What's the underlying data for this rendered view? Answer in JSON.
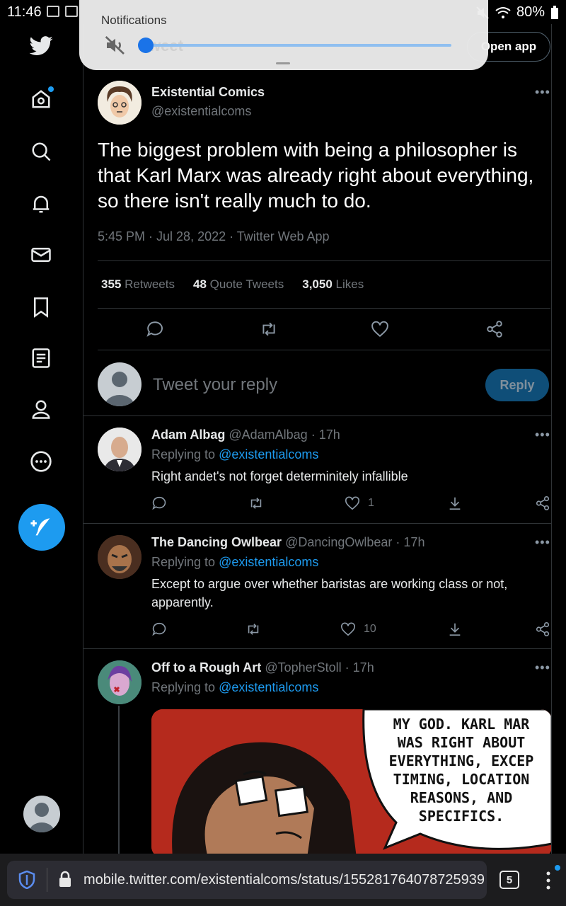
{
  "status_bar": {
    "time": "11:46",
    "battery": "80%"
  },
  "notification_panel": {
    "title": "Notifications",
    "header_ghost": "weet"
  },
  "header": {
    "open_app_label": "Open app"
  },
  "tweet": {
    "author_name": "Existential Comics",
    "author_handle": "@existentialcoms",
    "text": "The biggest problem with being a philosopher is that Karl Marx was already right about everything, so there isn't really much to do.",
    "meta": "5:45 PM · Jul 28, 2022 · Twitter Web App",
    "stats": [
      {
        "count": "355",
        "label": "Retweets"
      },
      {
        "count": "48",
        "label": "Quote Tweets"
      },
      {
        "count": "3,050",
        "label": "Likes"
      }
    ]
  },
  "reply_box": {
    "placeholder": "Tweet your reply",
    "button_label": "Reply"
  },
  "replies": [
    {
      "name": "Adam Albag",
      "handle": "@AdamAlbag",
      "time": "· 17h",
      "replying_label": "Replying to",
      "replying_to": "@existentialcoms",
      "text": "Right andet's not forget determinitely infallible",
      "likes": "1"
    },
    {
      "name": "The Dancing Owlbear",
      "handle": "@DancingOwlbear",
      "time": "· 17h",
      "replying_label": "Replying to",
      "replying_to": "@existentialcoms",
      "text": "Except to argue over whether baristas are working class or not, apparently.",
      "likes": "10"
    },
    {
      "name": "Off to a Rough Art",
      "handle": "@TopherStoll",
      "time": "· 17h",
      "replying_label": "Replying to",
      "replying_to": "@existentialcoms",
      "comic_text": [
        "MY GOD.  KARL MAR",
        "WAS RIGHT ABOUT",
        "EVERYTHING, EXCEP",
        "TIMING, LOCATION",
        "REASONS, AND",
        "SPECIFICS."
      ]
    }
  ],
  "browser": {
    "url": "mobile.twitter.com/existentialcoms/status/155281764078725939",
    "tab_count": "5"
  },
  "colors": {
    "accent": "#1d9bf0",
    "background": "#000000",
    "divider": "#2f3336",
    "muted": "#71767b"
  }
}
